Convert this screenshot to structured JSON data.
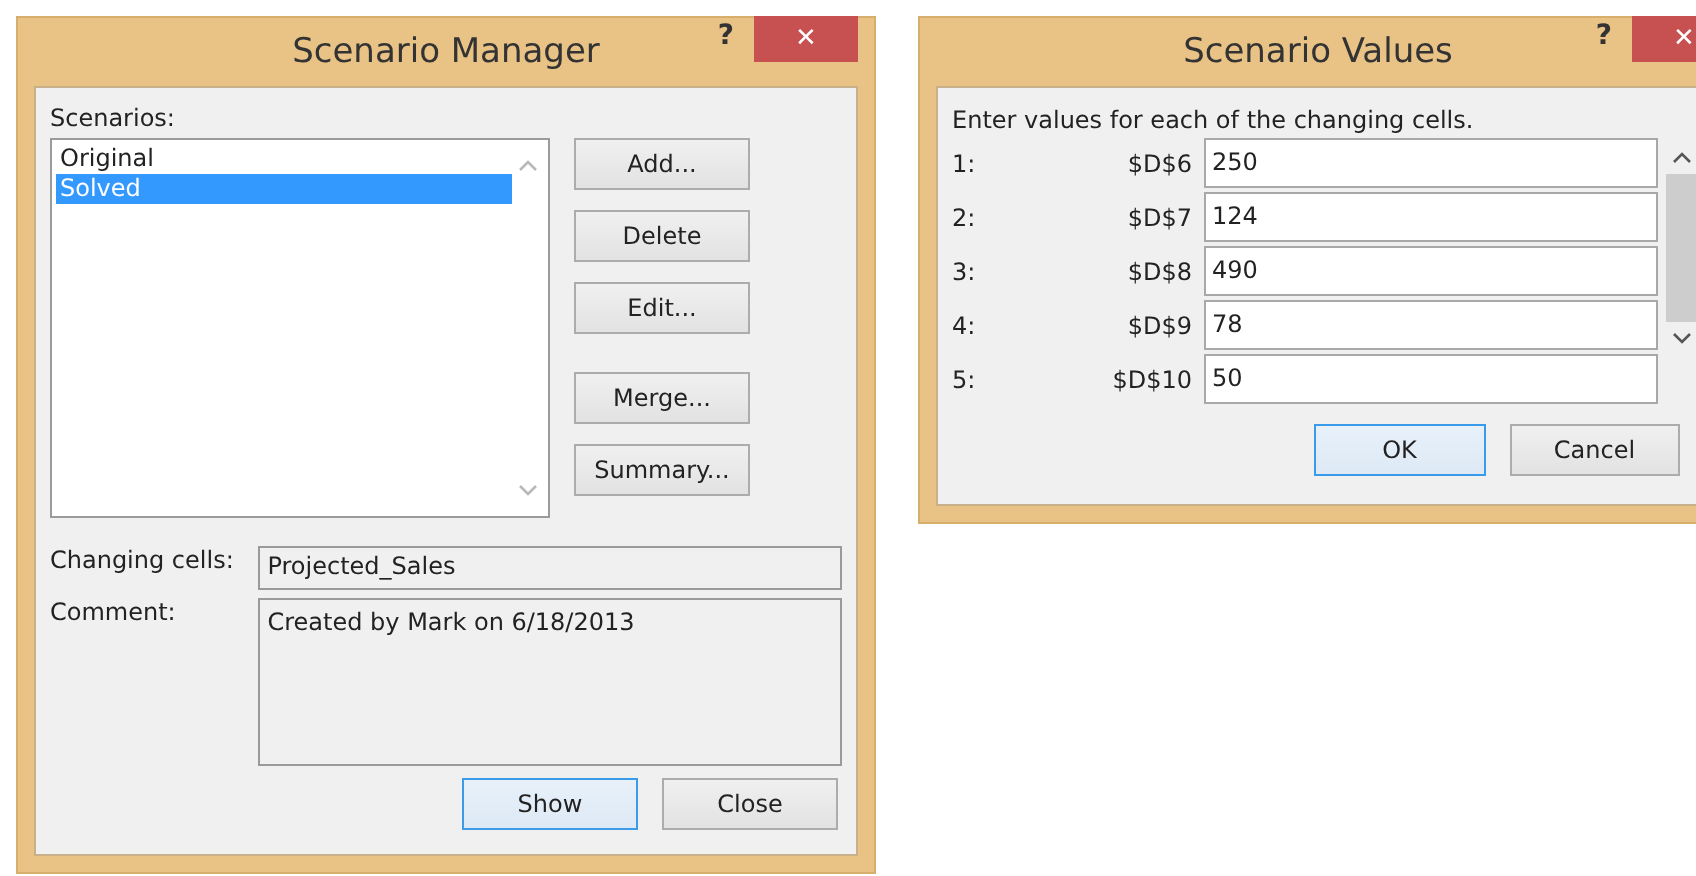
{
  "manager": {
    "title": "Scenario Manager",
    "help": "?",
    "close": "✕",
    "scenarios_label": "Scenarios:",
    "scenarios": [
      {
        "name": "Original",
        "selected": false
      },
      {
        "name": "Solved",
        "selected": true
      }
    ],
    "buttons": [
      "Add...",
      "Delete",
      "Edit...",
      "Merge...",
      "Summary..."
    ],
    "changing_cells_label": "Changing cells:",
    "changing_cells": "Projected_Sales",
    "comment_label": "Comment:",
    "comment": "Created by Mark on 6/18/2013",
    "footer_buttons": [
      {
        "label": "Show",
        "default": true
      },
      {
        "label": "Close",
        "default": false
      }
    ]
  },
  "values": {
    "title": "Scenario Values",
    "help": "?",
    "close": "✕",
    "instruction": "Enter values for each of the changing cells.",
    "rows": [
      {
        "index": "1:",
        "cell": "$D$6",
        "value": "250"
      },
      {
        "index": "2:",
        "cell": "$D$7",
        "value": "124"
      },
      {
        "index": "3:",
        "cell": "$D$8",
        "value": "490"
      },
      {
        "index": "4:",
        "cell": "$D$9",
        "value": "78"
      },
      {
        "index": "5:",
        "cell": "$D$10",
        "value": "50"
      }
    ],
    "footer_buttons": [
      {
        "label": "OK",
        "default": true
      },
      {
        "label": "Cancel",
        "default": false
      }
    ]
  }
}
